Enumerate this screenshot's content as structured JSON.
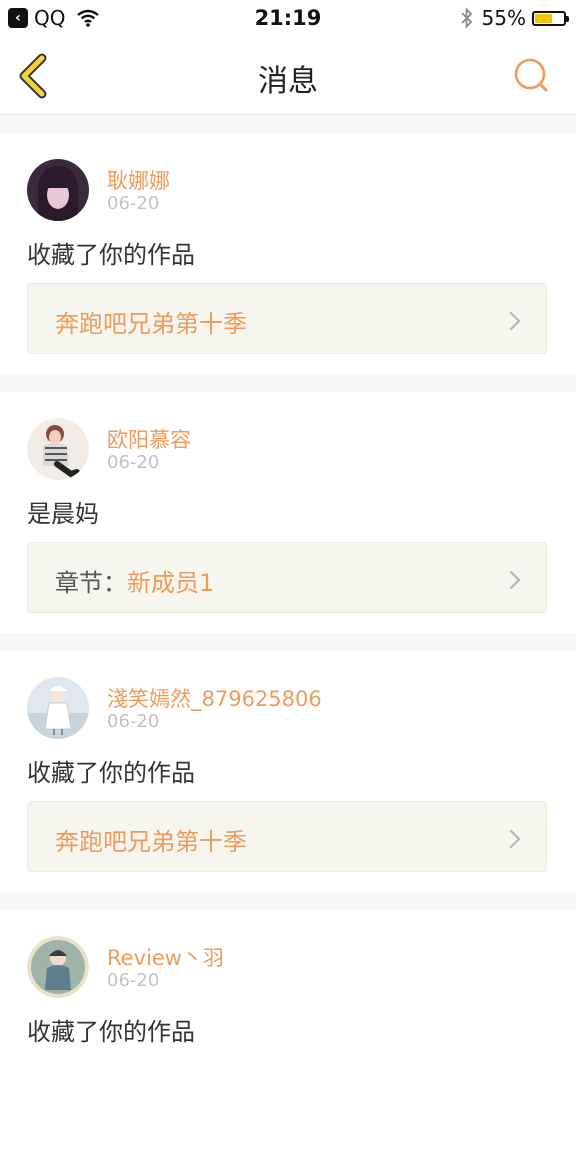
{
  "status_bar": {
    "back_app": "QQ",
    "time": "21:19",
    "battery_percent": "55%",
    "battery_level": 0.55
  },
  "nav": {
    "title": "消息",
    "back_icon": "chevron-left-icon",
    "search_icon": "search-icon"
  },
  "colors": {
    "accent": "#f09a5c",
    "back_arrow": "#f5c400"
  },
  "messages": [
    {
      "user": "耿娜娜",
      "date": "06-20",
      "text": "收藏了你的作品",
      "ref_prefix": "",
      "ref_title": "奔跑吧兄弟第十季"
    },
    {
      "user": "欧阳慕容",
      "date": "06-20",
      "text": "是晨妈",
      "ref_prefix": "章节：",
      "ref_title": "新成员1"
    },
    {
      "user": "淺笑嫣然_879625806",
      "date": "06-20",
      "text": "收藏了你的作品",
      "ref_prefix": "",
      "ref_title": "奔跑吧兄弟第十季"
    },
    {
      "user": "Review丶羽",
      "date": "06-20",
      "text": "收藏了你的作品",
      "ref_prefix": "",
      "ref_title": ""
    }
  ]
}
